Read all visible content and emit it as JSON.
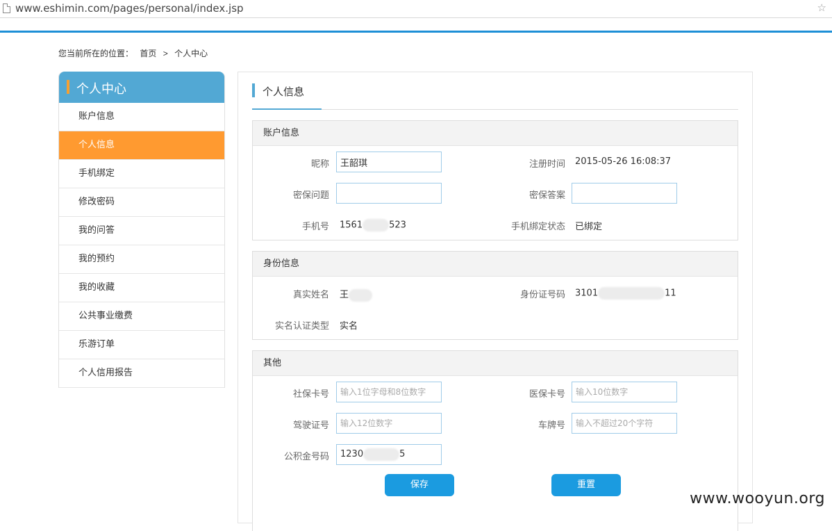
{
  "browser": {
    "url": "www.eshimin.com/pages/personal/index.jsp"
  },
  "breadcrumb": {
    "prefix": "您当前所在的位置：",
    "home": "首页",
    "separator": ">",
    "current": "个人中心"
  },
  "sidebar": {
    "title": "个人中心",
    "items": [
      {
        "label": "账户信息"
      },
      {
        "label": "个人信息",
        "active": true
      },
      {
        "label": "手机绑定"
      },
      {
        "label": "修改密码"
      },
      {
        "label": "我的问答"
      },
      {
        "label": "我的预约"
      },
      {
        "label": "我的收藏"
      },
      {
        "label": "公共事业缴费"
      },
      {
        "label": "乐游订单"
      },
      {
        "label": "个人信用报告"
      }
    ]
  },
  "main": {
    "tab_label": "个人信息",
    "account": {
      "title": "账户信息",
      "nickname_label": "昵称",
      "nickname_value": "王韶琪",
      "register_time_label": "注册时间",
      "register_time_value": "2015-05-26 16:08:37",
      "security_question_label": "密保问题",
      "security_question_value": "",
      "security_answer_label": "密保答案",
      "security_answer_value": "",
      "phone_label": "手机号",
      "phone_prefix": "1561",
      "phone_suffix": "523",
      "phone_bind_label": "手机绑定状态",
      "phone_bind_value": "已绑定"
    },
    "identity": {
      "title": "身份信息",
      "real_name_label": "真实姓名",
      "real_name_value": "王",
      "id_number_label": "身份证号码",
      "id_prefix": "3101",
      "id_suffix": "11",
      "auth_type_label": "实名认证类型",
      "auth_type_value": "实名"
    },
    "other": {
      "title": "其他",
      "social_card_label": "社保卡号",
      "social_card_placeholder": "输入1位字母和8位数字",
      "medical_card_label": "医保卡号",
      "medical_card_placeholder": "输入10位数字",
      "driver_license_label": "驾驶证号",
      "driver_license_placeholder": "输入12位数字",
      "plate_label": "车牌号",
      "plate_placeholder": "输入不超过20个字符",
      "fund_label": "公积金号码",
      "fund_prefix": "1230",
      "fund_suffix": "5"
    },
    "save_label": "保存",
    "reset_label": "重置"
  },
  "watermark": "www.wooyun.org"
}
